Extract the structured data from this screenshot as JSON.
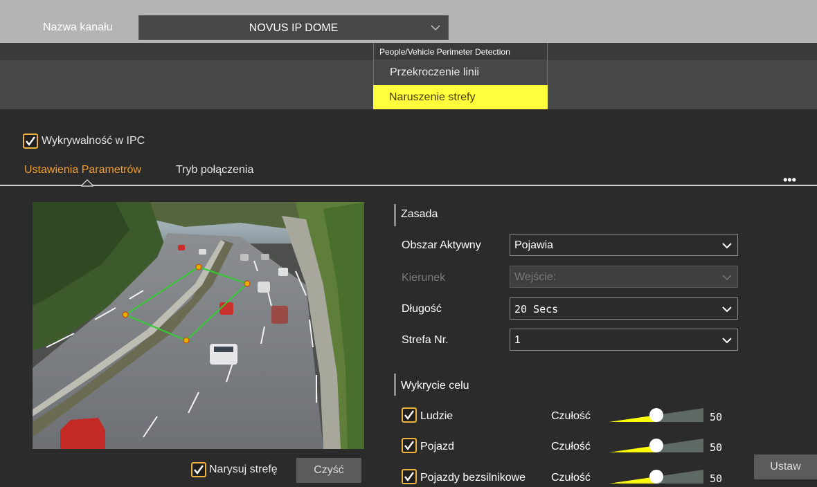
{
  "channel": {
    "label": "Nazwa kanału",
    "value": "NOVUS IP DOME"
  },
  "menu": {
    "header": "People/Vehicle Perimeter Detection",
    "items": [
      {
        "label": "Przekroczenie linii",
        "selected": false
      },
      {
        "label": "Naruszenie strefy",
        "selected": true
      }
    ]
  },
  "ipc": {
    "label": "Wykrywalność w IPC",
    "checked": true
  },
  "tabs": [
    {
      "label": "Ustawienia Parametrów",
      "active": true
    },
    {
      "label": "Tryb połączenia",
      "active": false
    }
  ],
  "more": "•••",
  "video": {
    "draw_zone": {
      "label": "Narysuj strefę",
      "checked": true
    },
    "clear_label": "Czyść"
  },
  "rule": {
    "title": "Zasada",
    "fields": [
      {
        "label": "Obszar Aktywny",
        "value": "Pojawia",
        "enabled": true
      },
      {
        "label": "Kierunek",
        "value": "Wejście:",
        "enabled": false
      },
      {
        "label": "Długość",
        "value": "20 Secs",
        "enabled": true
      },
      {
        "label": "Strefa Nr.",
        "value": "1",
        "enabled": true
      }
    ]
  },
  "targets": {
    "title": "Wykrycie celu",
    "sensitivity_label": "Czułość",
    "items": [
      {
        "label": "Ludzie",
        "checked": true,
        "sensitivity": 50
      },
      {
        "label": "Pojazd",
        "checked": true,
        "sensitivity": 50
      },
      {
        "label": "Pojazdy bezsilnikowe",
        "checked": true,
        "sensitivity": 50
      }
    ]
  },
  "set_label": "Ustaw",
  "colors": {
    "accent": "#f0a030",
    "highlight": "#ffff3c",
    "slider_fill": "#ffff00",
    "zone": "#33cc33"
  }
}
